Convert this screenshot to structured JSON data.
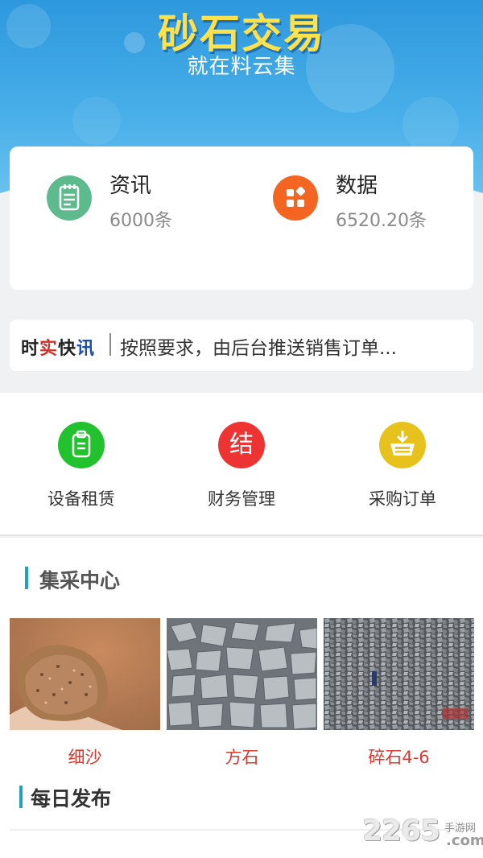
{
  "header": {
    "title": "砂石交易",
    "subtitle": "就在料云集"
  },
  "stats": [
    {
      "label": "资讯",
      "value": "6000条",
      "icon": "document-icon",
      "color": "#5dba8c"
    },
    {
      "label": "数据",
      "value": "6520.20条",
      "icon": "grid-icon",
      "color": "#f46522"
    }
  ],
  "ticker": {
    "brand": [
      "时",
      "实",
      "快",
      "讯"
    ],
    "text": "按照要求，由后台推送销售订单..."
  },
  "actions": [
    {
      "label": "设备租赁",
      "icon": "clipboard-icon",
      "color": "#22c22e"
    },
    {
      "label": "财务管理",
      "icon_text": "结",
      "color": "#ee3333"
    },
    {
      "label": "采购订单",
      "icon": "basket-icon",
      "color": "#e8c21c"
    }
  ],
  "section_procurement": {
    "title": "集采中心",
    "products": [
      {
        "name": "细沙"
      },
      {
        "name": "方石"
      },
      {
        "name": "碎石4-6"
      }
    ]
  },
  "section_daily": {
    "title": "每日发布"
  },
  "watermark": {
    "number": "2265",
    "site": "手游网",
    "suffix": ".com"
  },
  "colors": {
    "header_blue": "#2d98dd",
    "title_yellow": "#ffe14b",
    "accent_bar": "#23a1c4",
    "product_red": "#d63a30"
  }
}
